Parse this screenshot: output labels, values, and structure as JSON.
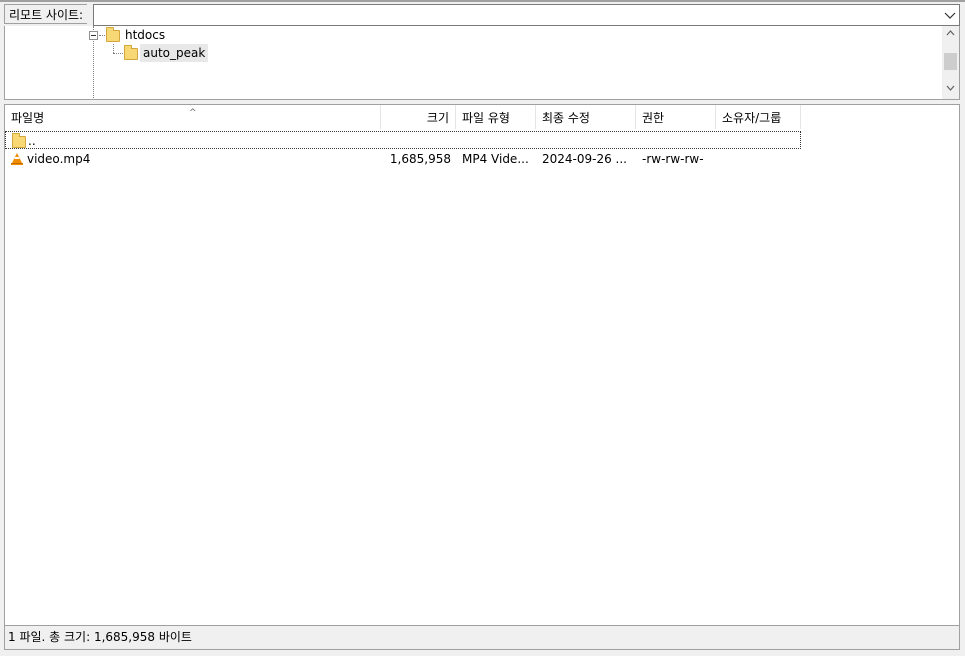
{
  "remote_site": {
    "label": "리모트 사이트:",
    "value": ""
  },
  "tree": {
    "items": [
      {
        "label": "htdocs",
        "expanded": true
      },
      {
        "label": "auto_peak",
        "selected": true
      }
    ]
  },
  "filelist": {
    "columns": {
      "name": "파일명",
      "size": "크기",
      "type": "파일 유형",
      "modified": "최종 수정",
      "perms": "권한",
      "owner": "소유자/그룹"
    },
    "rows": [
      {
        "name": "..",
        "size": "",
        "type": "",
        "modified": "",
        "perms": "",
        "owner": ""
      },
      {
        "name": "video.mp4",
        "size": "1,685,958",
        "type": "MP4 Vide...",
        "modified": "2024-09-26 ...",
        "perms": "-rw-rw-rw-",
        "owner": ""
      }
    ]
  },
  "status": {
    "text": "1 파일. 총 크기: 1,685,958 바이트"
  },
  "icons": {
    "parent": "folder-icon",
    "file": "vlc-icon"
  }
}
